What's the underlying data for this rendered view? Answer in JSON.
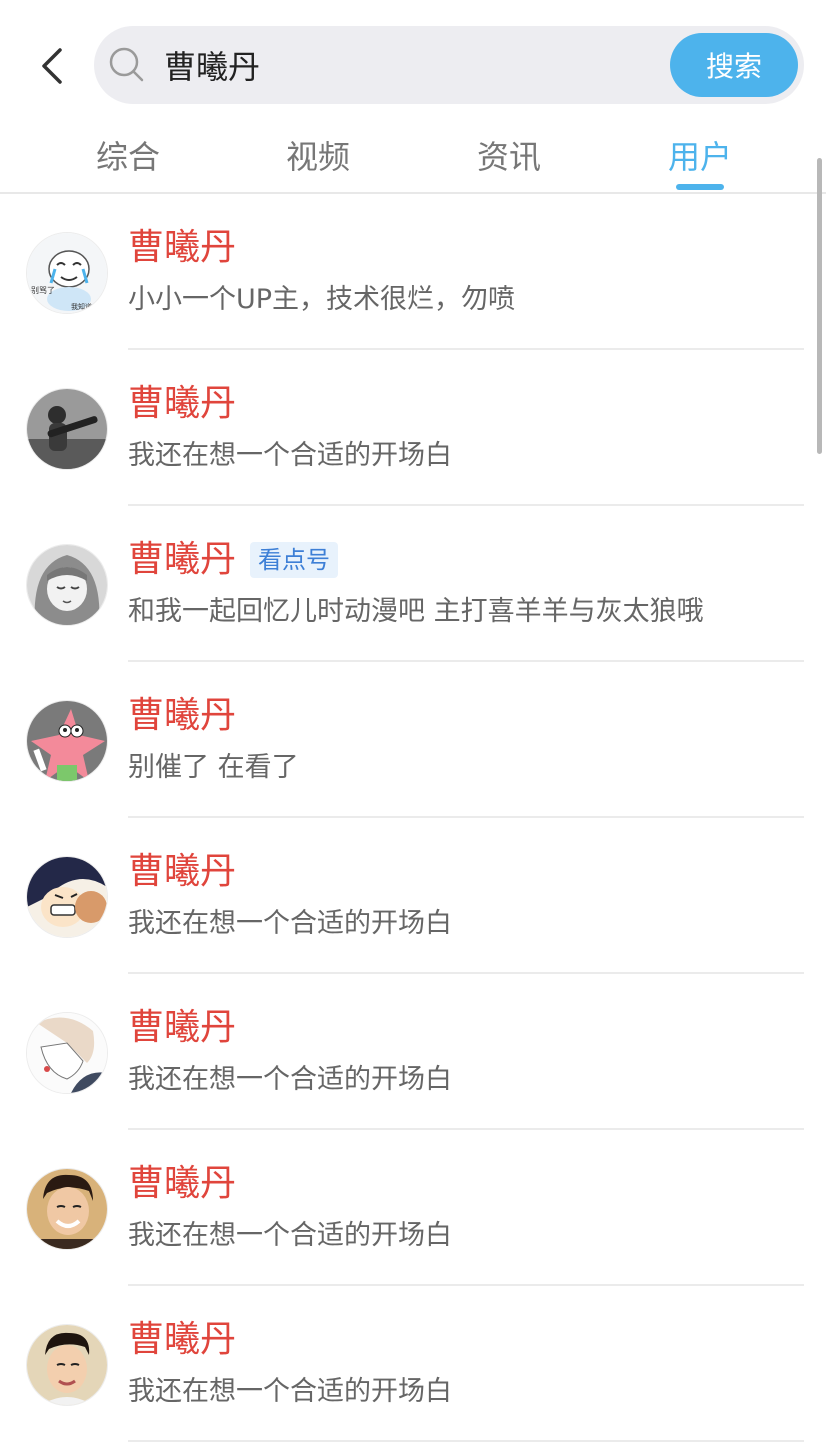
{
  "header": {
    "search_value": "曹曦丹",
    "search_button": "搜索"
  },
  "tabs": [
    {
      "label": "综合",
      "active": false
    },
    {
      "label": "视频",
      "active": false
    },
    {
      "label": "资讯",
      "active": false
    },
    {
      "label": "用户",
      "active": true
    }
  ],
  "colors": {
    "accent": "#4db3ec",
    "name": "#e0453c",
    "badge_text": "#3d7fd6"
  },
  "users": [
    {
      "name": "曹曦丹",
      "badge": "",
      "desc": "小小一个UP主，技术很烂，勿喷",
      "avatar_icon": "meme-avatar",
      "avatar_caption_1": "别骂了",
      "avatar_caption_2": "我知道"
    },
    {
      "name": "曹曦丹",
      "badge": "",
      "desc": "我还在想一个合适的开场白",
      "avatar_icon": "grayscale-photo-avatar"
    },
    {
      "name": "曹曦丹",
      "badge": "看点号",
      "desc": "和我一起回忆儿时动漫吧 主打喜羊羊与灰太狼哦",
      "avatar_icon": "anime-girl-avatar"
    },
    {
      "name": "曹曦丹",
      "badge": "",
      "desc": "别催了 在看了",
      "avatar_icon": "patrick-star-avatar"
    },
    {
      "name": "曹曦丹",
      "badge": "",
      "desc": "我还在想一个合适的开场白",
      "avatar_icon": "cartoon-face-avatar"
    },
    {
      "name": "曹曦丹",
      "badge": "",
      "desc": "我还在想一个合适的开场白",
      "avatar_icon": "anime-boy-avatar"
    },
    {
      "name": "曹曦丹",
      "badge": "",
      "desc": "我还在想一个合适的开场白",
      "avatar_icon": "smiling-man-avatar"
    },
    {
      "name": "曹曦丹",
      "badge": "",
      "desc": "我还在想一个合适的开场白",
      "avatar_icon": "man-portrait-avatar"
    }
  ]
}
